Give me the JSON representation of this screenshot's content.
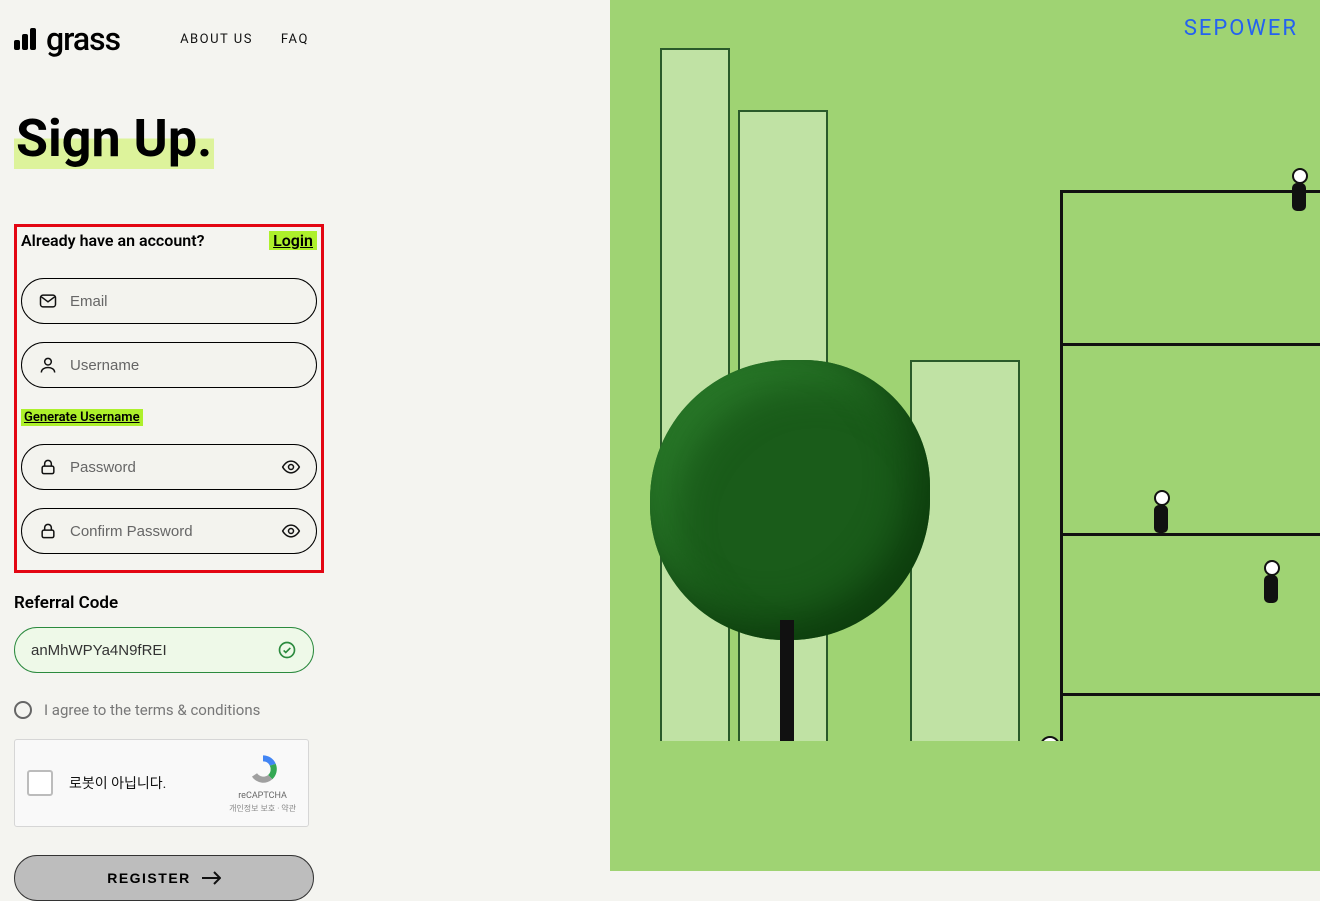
{
  "brand": {
    "name": "grass"
  },
  "nav": {
    "about": "ABOUT US",
    "faq": "FAQ"
  },
  "title": "Sign Up.",
  "form": {
    "already_text": "Already have an account?",
    "login_label": "Login",
    "email_placeholder": "Email",
    "username_placeholder": "Username",
    "generate_label": "Generate Username",
    "password_placeholder": "Password",
    "confirm_placeholder": "Confirm Password",
    "referral_label": "Referral Code",
    "referral_value": "anMhWPYa4N9fREI",
    "terms_label": "I agree to the terms & conditions",
    "register_label": "REGISTER"
  },
  "recaptcha": {
    "label": "로봇이 아닙니다.",
    "brand": "reCAPTCHA",
    "links": "개인정보 보호 · 약관"
  },
  "overlay": {
    "sepower": "SEPOWER"
  }
}
